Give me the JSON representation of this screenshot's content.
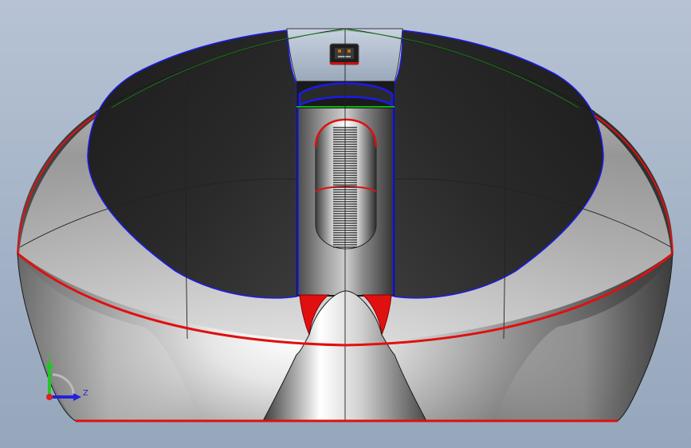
{
  "viewport": {
    "background_top": "#b7c3d4",
    "background_bottom": "#96a6bb"
  },
  "model": {
    "body_color": "#8a8a8a",
    "dark_panel_color": "#262626",
    "edge_red": "#e01010",
    "edge_blue": "#1a1aee",
    "edge_green": "#10b010"
  },
  "triad": {
    "y_label": "Y",
    "z_label": "Z",
    "y_color": "#22c822",
    "z_color": "#2222dd",
    "origin_color": "#dd2222"
  }
}
